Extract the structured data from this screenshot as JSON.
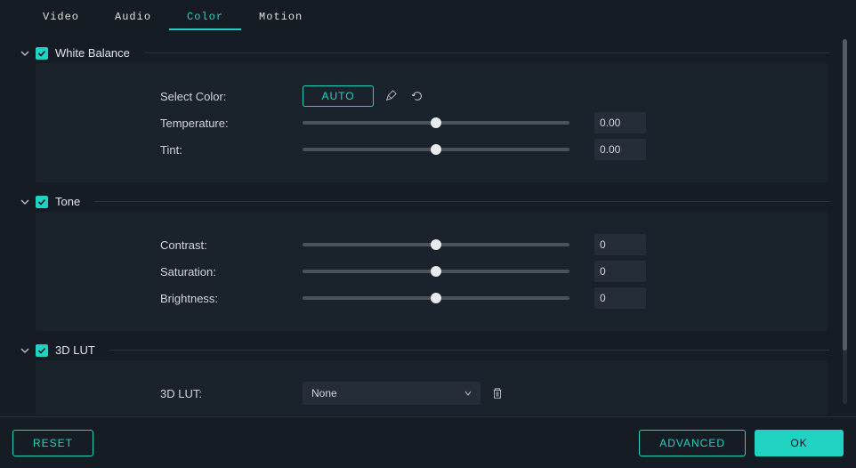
{
  "tabs": {
    "video": "Video",
    "audio": "Audio",
    "color": "Color",
    "motion": "Motion",
    "active": "color"
  },
  "sections": {
    "whiteBalance": {
      "title": "White Balance",
      "selectColorLabel": "Select Color:",
      "autoBtn": "AUTO",
      "temperature": {
        "label": "Temperature:",
        "value": "0.00"
      },
      "tint": {
        "label": "Tint:",
        "value": "0.00"
      }
    },
    "tone": {
      "title": "Tone",
      "contrast": {
        "label": "Contrast:",
        "value": "0"
      },
      "saturation": {
        "label": "Saturation:",
        "value": "0"
      },
      "brightness": {
        "label": "Brightness:",
        "value": "0"
      }
    },
    "lut3d": {
      "title": "3D LUT",
      "label": "3D LUT:",
      "selected": "None"
    }
  },
  "footer": {
    "reset": "RESET",
    "advanced": "ADVANCED",
    "ok": "OK"
  },
  "colors": {
    "accent": "#20d2c2",
    "bg": "#151c24",
    "panel": "#1a222c"
  }
}
